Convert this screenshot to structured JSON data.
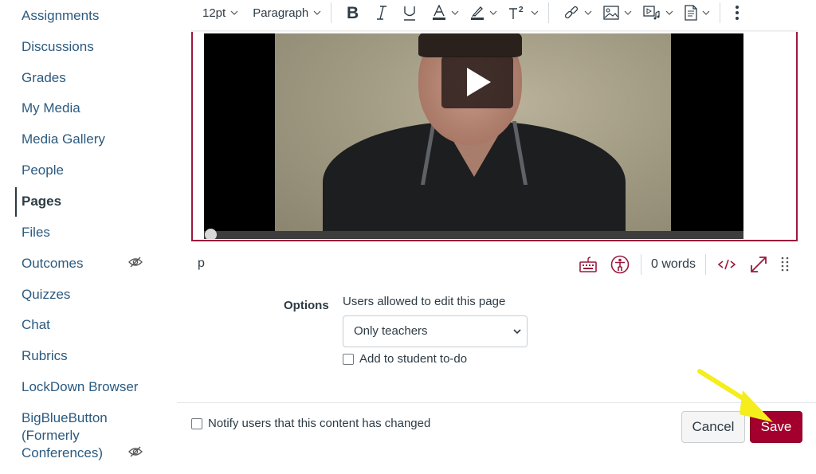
{
  "sidebar": {
    "items": [
      {
        "label": "Assignments",
        "hidden": false,
        "active": false
      },
      {
        "label": "Discussions",
        "hidden": false,
        "active": false
      },
      {
        "label": "Grades",
        "hidden": false,
        "active": false
      },
      {
        "label": "My Media",
        "hidden": false,
        "active": false
      },
      {
        "label": "Media Gallery",
        "hidden": false,
        "active": false
      },
      {
        "label": "People",
        "hidden": false,
        "active": false
      },
      {
        "label": "Pages",
        "hidden": false,
        "active": true
      },
      {
        "label": "Files",
        "hidden": false,
        "active": false
      },
      {
        "label": "Outcomes",
        "hidden": true,
        "active": false
      },
      {
        "label": "Quizzes",
        "hidden": false,
        "active": false
      },
      {
        "label": "Chat",
        "hidden": false,
        "active": false
      },
      {
        "label": "Rubrics",
        "hidden": false,
        "active": false
      },
      {
        "label": "LockDown Browser",
        "hidden": false,
        "active": false
      },
      {
        "label": "BigBlueButton (Formerly Conferences)",
        "hidden": true,
        "active": false
      }
    ]
  },
  "toolbar": {
    "font_size": "12pt",
    "block_format": "Paragraph",
    "buttons": [
      "bold-icon",
      "italic-icon",
      "underline-icon",
      "text-color-icon",
      "highlight-icon",
      "superscript-icon",
      "link-icon",
      "image-icon",
      "media-icon",
      "document-icon",
      "more-icon"
    ]
  },
  "editor": {
    "content": "embedded video",
    "video_icon": "play-icon",
    "progress": 0
  },
  "statusbar": {
    "path": "p",
    "word_count": "0 words",
    "accent": "#9b1a3c"
  },
  "options": {
    "label": "Options",
    "edit_permission_label": "Users allowed to edit this page",
    "edit_permission_value": "Only teachers",
    "todo_label": "Add to student to-do",
    "todo_checked": false
  },
  "footer": {
    "notify_label": "Notify users that this content has changed",
    "notify_checked": false,
    "cancel_label": "Cancel",
    "save_label": "Save",
    "save_color": "#a3002d",
    "annotation": "yellow arrow pointing to Save"
  }
}
